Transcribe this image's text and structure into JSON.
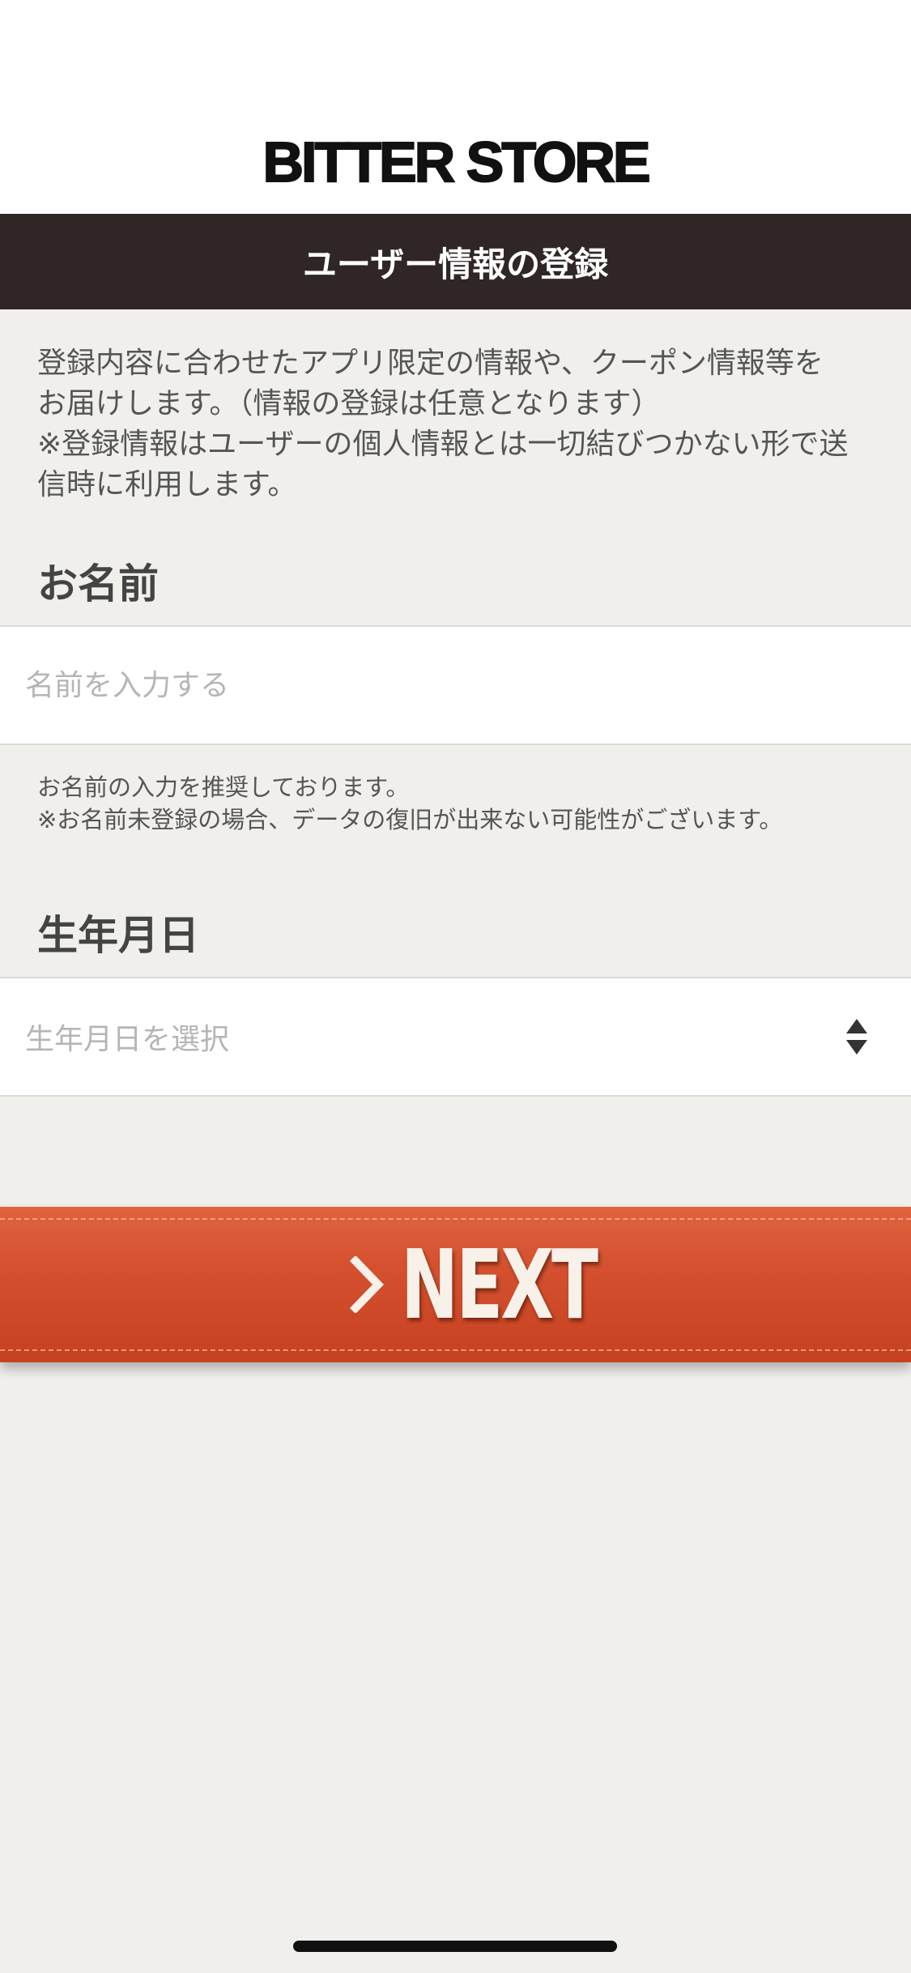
{
  "brand": {
    "logo_text": "BITTER STORE"
  },
  "header": {
    "title": "ユーザー情報の登録"
  },
  "intro": {
    "line1": "登録内容に合わせたアプリ限定の情報や、クーポン情報等を",
    "line2": "お届けします。（情報の登録は任意となります）",
    "line3": "※登録情報はユーザーの個人情報とは一切結びつかない形で送",
    "line4": "信時に利用します。"
  },
  "name_section": {
    "label": "お名前",
    "placeholder": "名前を入力する",
    "value": "",
    "note_line1": "お名前の入力を推奨しております。",
    "note_line2": "※お名前未登録の場合、データの復旧が出来ない可能性がございます。"
  },
  "birthday_section": {
    "label": "生年月日",
    "placeholder": "生年月日を選択"
  },
  "actions": {
    "next_label": "NEXT"
  },
  "icons": {
    "select": "up-down-arrows-icon",
    "next": "chevron-right-icon"
  },
  "colors": {
    "header_bg": "#312626",
    "page_bg": "#f0efec",
    "button": "#d4502e"
  }
}
